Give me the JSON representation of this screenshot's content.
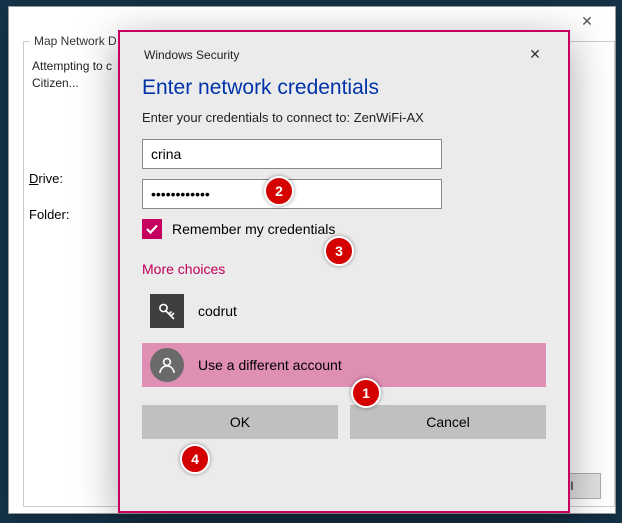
{
  "outer": {
    "map_title": "Map Network D",
    "msg_line1": "Attempting to c",
    "msg_line2": "Citizen...",
    "drive_label": "rive:",
    "folder_label": "older:",
    "cancel_label": "ancel"
  },
  "sec": {
    "window_title": "Windows Security",
    "heading": "Enter network credentials",
    "prompt": "Enter your credentials to connect to: ZenWiFi-AX",
    "username": "crina",
    "password": "••••••••••••",
    "remember_label": "Remember my credentials",
    "remember_checked": true,
    "more_choices": "More choices",
    "account1": "codrut",
    "account2": "Use a different account",
    "ok_label": "OK",
    "cancel_label": "Cancel"
  },
  "callouts": {
    "c1": "1",
    "c2": "2",
    "c3": "3",
    "c4": "4"
  },
  "colors": {
    "accent": "#c6005e",
    "badge": "#d40000",
    "heading": "#0033aa"
  }
}
